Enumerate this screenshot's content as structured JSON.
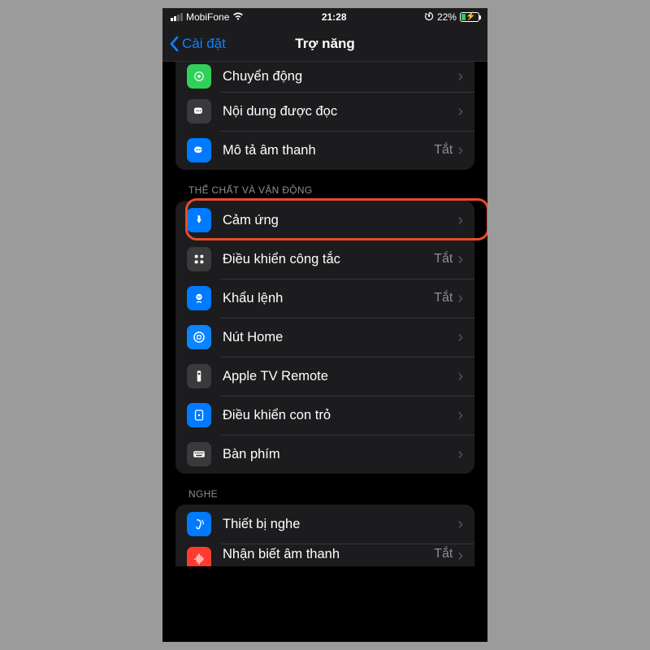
{
  "status": {
    "carrier": "MobiFone",
    "time": "21:28",
    "battery_pct": "22%"
  },
  "nav": {
    "back": "Cài đặt",
    "title": "Trợ năng"
  },
  "group_vision": {
    "items": [
      {
        "icon": "motion",
        "label": "Chuyển động",
        "value": ""
      },
      {
        "icon": "spoken",
        "label": "Nội dung được đọc",
        "value": ""
      },
      {
        "icon": "audiodesc",
        "label": "Mô tả âm thanh",
        "value": "Tắt"
      }
    ]
  },
  "section_physical": "THỂ CHẤT VÀ VẬN ĐỘNG",
  "group_physical": {
    "items": [
      {
        "icon": "touch",
        "label": "Cảm ứng",
        "value": ""
      },
      {
        "icon": "switch",
        "label": "Điều khiển công tắc",
        "value": "Tắt"
      },
      {
        "icon": "voice",
        "label": "Khẩu lệnh",
        "value": "Tắt"
      },
      {
        "icon": "home",
        "label": "Nút Home",
        "value": ""
      },
      {
        "icon": "tvremote",
        "label": "Apple TV Remote",
        "value": ""
      },
      {
        "icon": "pointer",
        "label": "Điều khiển con trỏ",
        "value": ""
      },
      {
        "icon": "keyboard",
        "label": "Bàn phím",
        "value": ""
      }
    ]
  },
  "section_hearing": "NGHE",
  "group_hearing": {
    "items": [
      {
        "icon": "hearing",
        "label": "Thiết bị nghe",
        "value": ""
      },
      {
        "icon": "soundrec",
        "label": "Nhận biết âm thanh",
        "value": "Tắt"
      }
    ]
  }
}
